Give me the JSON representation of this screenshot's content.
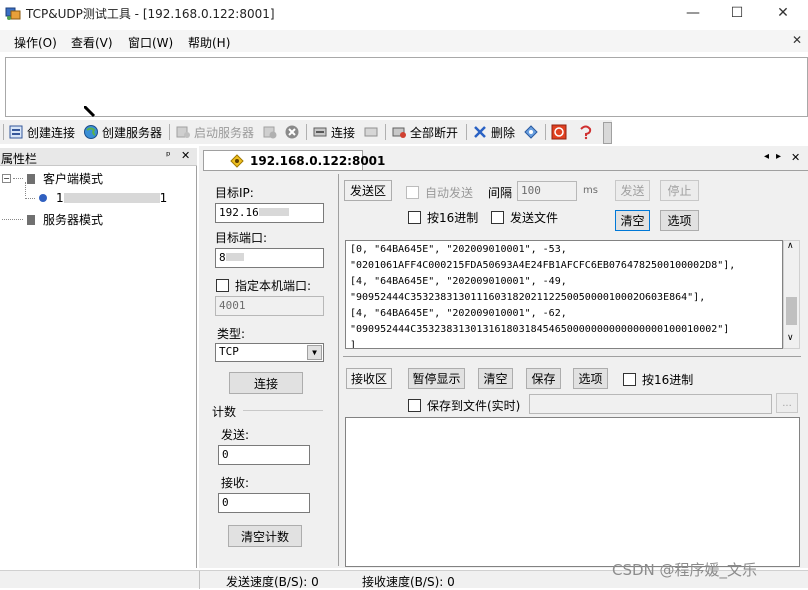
{
  "window": {
    "title": "TCP&UDP测试工具 - [192.168.0.122:8001]",
    "minimize_glyph": "—",
    "maximize_glyph": "☐",
    "close_glyph": "✕"
  },
  "menu": {
    "items": [
      "操作(O)",
      "查看(V)",
      "窗口(W)",
      "帮助(H)"
    ],
    "close_glyph": "✕"
  },
  "toolbar": {
    "create_connection": "创建连接",
    "create_server": "创建服务器",
    "start_server": "启动服务器",
    "connect": "连接",
    "disconnect_all": "全部断开",
    "delete": "删除"
  },
  "sidebar": {
    "title": "属性栏",
    "pin_glyph": "ᵃ",
    "close_glyph": "✕",
    "client_mode": "客户端模式",
    "client_item": "1",
    "client_item_suffix": "1",
    "server_mode": "服务器模式"
  },
  "tab": {
    "label": "192.168.0.122:8001",
    "nav_left": "◂",
    "nav_right": "▸",
    "close_glyph": "✕"
  },
  "connection": {
    "target_ip_label": "目标IP:",
    "target_ip_value": "192.16",
    "target_port_label": "目标端口:",
    "target_port_value": "8",
    "local_port_label": "指定本机端口:",
    "local_port_value": "4001",
    "type_label": "类型:",
    "type_value": "TCP",
    "connect_button": "连接"
  },
  "counter": {
    "section_label": "计数",
    "send_label": "发送:",
    "send_value": "0",
    "recv_label": "接收:",
    "recv_value": "0",
    "clear_button": "清空计数"
  },
  "send_area": {
    "tab_label": "发送区",
    "auto_send": "自动发送",
    "interval_label": "间隔",
    "interval_value": "100",
    "interval_unit": "ms",
    "send_button": "发送",
    "stop_button": "停止",
    "hex_label": "按16进制",
    "send_file_label": "发送文件",
    "clear_button": "清空",
    "options_button": "选项",
    "lines": [
      "[0, \"64BA645E\", \"202009010001\", -53,",
      "\"0201061AFF4C000215FDA50693A4E24FB1AFCFC6EB0764782500100002D8\"],",
      "[4, \"64BA645E\", \"202009010001\", -49,",
      "\"90952444C35323831301116031820211225005000010002O603E864\"],",
      "[4, \"64BA645E\", \"202009010001\", -62,",
      "\"090952444C35323831301316180318454650000000000000000100010002\"]",
      "]"
    ]
  },
  "recv_area": {
    "tab_label": "接收区",
    "pause_button": "暂停显示",
    "clear_button": "清空",
    "save_button": "保存",
    "options_button": "选项",
    "hex_label": "按16进制",
    "save_to_file_label": "保存到文件(实时)",
    "browse_button": "..."
  },
  "status": {
    "send_speed": "发送速度(B/S): 0",
    "recv_speed": "接收速度(B/S): 0"
  },
  "watermark": "CSDN @程序媛_文乐"
}
